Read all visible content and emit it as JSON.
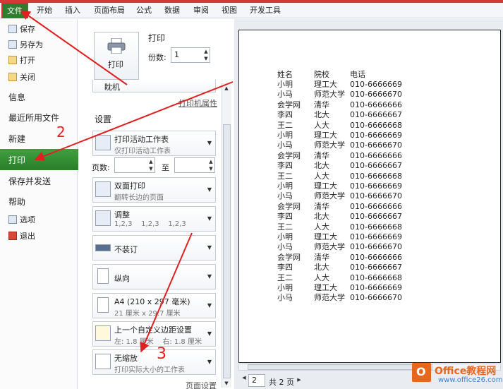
{
  "ribbon": {
    "tabs": [
      {
        "label": "文件"
      },
      {
        "label": "开始"
      },
      {
        "label": "插入"
      },
      {
        "label": "页面布局"
      },
      {
        "label": "公式"
      },
      {
        "label": "数据"
      },
      {
        "label": "审阅"
      },
      {
        "label": "视图"
      },
      {
        "label": "开发工具"
      }
    ]
  },
  "nav": {
    "save": "保存",
    "save_as": "另存为",
    "open": "打开",
    "close": "关闭",
    "info": "信息",
    "recent": "最近所用文件",
    "new": "新建",
    "print": "打印",
    "save_send": "保存并发送",
    "help": "帮助",
    "options": "选项",
    "exit": "退出"
  },
  "print_panel": {
    "heading": "打印",
    "print_button": "打印",
    "copies_label": "份数:",
    "copies_value": "1",
    "printer_partial": "眈机",
    "printer_properties": "打印机属性",
    "settings_heading": "设置",
    "pages_label": "页数:",
    "to_label": "至",
    "page_setup": "页面设置",
    "combos": [
      {
        "main": "打印活动工作表",
        "sub": "仅打印活动工作表"
      },
      {
        "main": "双面打印",
        "sub": "翻转长边的页面"
      },
      {
        "main": "调整",
        "sub": "1,2,3    1,2,3    1,2,3"
      },
      {
        "main": "不装订",
        "sub": ""
      },
      {
        "main": "纵向",
        "sub": ""
      },
      {
        "main": "A4 (210 x 297 毫米)",
        "sub": "21 厘米 x 29.7 厘米"
      },
      {
        "main": "上一个自定义边距设置",
        "sub": "左: 1.8 厘米    右: 1.8 厘米"
      },
      {
        "main": "无缩放",
        "sub": "打印实际大小的工作表"
      }
    ]
  },
  "preview": {
    "header": [
      "姓名",
      "院校",
      "电话"
    ],
    "rows": [
      [
        "小明",
        "理工大",
        "010-6666669"
      ],
      [
        "小马",
        "师范大学",
        "010-6666670"
      ],
      [
        "会学网",
        "清华",
        "010-6666666"
      ],
      [
        "李四",
        "北大",
        "010-6666667"
      ],
      [
        "王二",
        "人大",
        "010-6666668"
      ],
      [
        "小明",
        "理工大",
        "010-6666669"
      ],
      [
        "小马",
        "师范大学",
        "010-6666670"
      ],
      [
        "会学网",
        "清华",
        "010-6666666"
      ],
      [
        "李四",
        "北大",
        "010-6666667"
      ],
      [
        "王二",
        "人大",
        "010-6666668"
      ],
      [
        "小明",
        "理工大",
        "010-6666669"
      ],
      [
        "小马",
        "师范大学",
        "010-6666670"
      ],
      [
        "会学网",
        "清华",
        "010-6666666"
      ],
      [
        "李四",
        "北大",
        "010-6666667"
      ],
      [
        "王二",
        "人大",
        "010-6666668"
      ],
      [
        "小明",
        "理工大",
        "010-6666669"
      ],
      [
        "小马",
        "师范大学",
        "010-6666670"
      ],
      [
        "会学网",
        "清华",
        "010-6666666"
      ],
      [
        "李四",
        "北大",
        "010-6666667"
      ],
      [
        "王二",
        "人大",
        "010-6666668"
      ],
      [
        "小明",
        "理工大",
        "010-6666669"
      ],
      [
        "小马",
        "师范大学",
        "010-6666670"
      ]
    ],
    "page_current": "2",
    "page_total": "共 2 页"
  },
  "annotations": {
    "step2": "2",
    "step3": "3"
  },
  "logo": {
    "title": "Office教程网",
    "url": "www.office26.com"
  },
  "colors": {
    "accent_green": "#2a7e2a",
    "annotation_red": "#e02020",
    "logo_orange": "#e8671e"
  }
}
